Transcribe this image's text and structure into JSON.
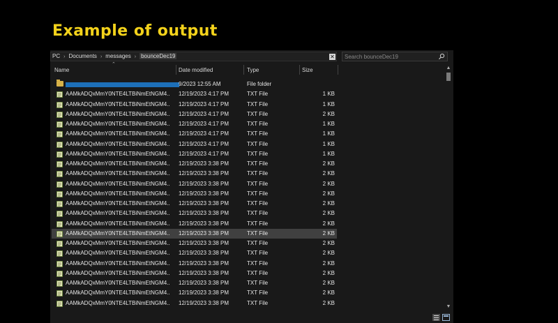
{
  "slide": {
    "title": "Example of output"
  },
  "address": {
    "crumbs": [
      "PC",
      "Documents",
      "messages",
      "bounceDec19"
    ],
    "clear_glyph": "✕"
  },
  "search": {
    "placeholder": "Search bounceDec19"
  },
  "columns": {
    "name": "Name",
    "date": "Date modified",
    "type": "Type",
    "size": "Size"
  },
  "folder_row": {
    "date": "9/2023 12:55 AM",
    "type": "File folder"
  },
  "files": [
    {
      "name": "AAMkADQxMmY0NTE4LTBiNmEtNGM4...",
      "date": "12/19/2023 4:17 PM",
      "type": "TXT File",
      "size": "1 KB"
    },
    {
      "name": "AAMkADQxMmY0NTE4LTBiNmEtNGM4...",
      "date": "12/19/2023 4:17 PM",
      "type": "TXT File",
      "size": "1 KB"
    },
    {
      "name": "AAMkADQxMmY0NTE4LTBiNmEtNGM4...",
      "date": "12/19/2023 4:17 PM",
      "type": "TXT File",
      "size": "2 KB"
    },
    {
      "name": "AAMkADQxMmY0NTE4LTBiNmEtNGM4...",
      "date": "12/19/2023 4:17 PM",
      "type": "TXT File",
      "size": "1 KB"
    },
    {
      "name": "AAMkADQxMmY0NTE4LTBiNmEtNGM4...",
      "date": "12/19/2023 4:17 PM",
      "type": "TXT File",
      "size": "1 KB"
    },
    {
      "name": "AAMkADQxMmY0NTE4LTBiNmEtNGM4...",
      "date": "12/19/2023 4:17 PM",
      "type": "TXT File",
      "size": "1 KB"
    },
    {
      "name": "AAMkADQxMmY0NTE4LTBiNmEtNGM4...",
      "date": "12/19/2023 4:17 PM",
      "type": "TXT File",
      "size": "1 KB"
    },
    {
      "name": "AAMkADQxMmY0NTE4LTBiNmEtNGM4...",
      "date": "12/19/2023 3:38 PM",
      "type": "TXT File",
      "size": "2 KB"
    },
    {
      "name": "AAMkADQxMmY0NTE4LTBiNmEtNGM4...",
      "date": "12/19/2023 3:38 PM",
      "type": "TXT File",
      "size": "2 KB"
    },
    {
      "name": "AAMkADQxMmY0NTE4LTBiNmEtNGM4...",
      "date": "12/19/2023 3:38 PM",
      "type": "TXT File",
      "size": "2 KB"
    },
    {
      "name": "AAMkADQxMmY0NTE4LTBiNmEtNGM4...",
      "date": "12/19/2023 3:38 PM",
      "type": "TXT File",
      "size": "2 KB"
    },
    {
      "name": "AAMkADQxMmY0NTE4LTBiNmEtNGM4...",
      "date": "12/19/2023 3:38 PM",
      "type": "TXT File",
      "size": "2 KB"
    },
    {
      "name": "AAMkADQxMmY0NTE4LTBiNmEtNGM4...",
      "date": "12/19/2023 3:38 PM",
      "type": "TXT File",
      "size": "2 KB"
    },
    {
      "name": "AAMkADQxMmY0NTE4LTBiNmEtNGM4...",
      "date": "12/19/2023 3:38 PM",
      "type": "TXT File",
      "size": "2 KB"
    },
    {
      "name": "AAMkADQxMmY0NTE4LTBiNmEtNGM4...",
      "date": "12/19/2023 3:38 PM",
      "type": "TXT File",
      "size": "2 KB",
      "highlighted": true
    },
    {
      "name": "AAMkADQxMmY0NTE4LTBiNmEtNGM4...",
      "date": "12/19/2023 3:38 PM",
      "type": "TXT File",
      "size": "2 KB"
    },
    {
      "name": "AAMkADQxMmY0NTE4LTBiNmEtNGM4...",
      "date": "12/19/2023 3:38 PM",
      "type": "TXT File",
      "size": "2 KB"
    },
    {
      "name": "AAMkADQxMmY0NTE4LTBiNmEtNGM4...",
      "date": "12/19/2023 3:38 PM",
      "type": "TXT File",
      "size": "2 KB"
    },
    {
      "name": "AAMkADQxMmY0NTE4LTBiNmEtNGM4...",
      "date": "12/19/2023 3:38 PM",
      "type": "TXT File",
      "size": "2 KB"
    },
    {
      "name": "AAMkADQxMmY0NTE4LTBiNmEtNGM4...",
      "date": "12/19/2023 3:38 PM",
      "type": "TXT File",
      "size": "2 KB"
    },
    {
      "name": "AAMkADQxMmY0NTE4LTBiNmEtNGM4...",
      "date": "12/19/2023 3:38 PM",
      "type": "TXT File",
      "size": "2 KB"
    },
    {
      "name": "AAMkADQxMmY0NTE4LTBiNmEtNGM4...",
      "date": "12/19/2023 3:38 PM",
      "type": "TXT File",
      "size": "2 KB"
    }
  ],
  "colors": {
    "title": "#f3d21b",
    "background": "#000000",
    "explorer_bg": "#191919",
    "text": "#e6e6e6",
    "row_highlight": "#404040",
    "redaction_bar": "#1d6fb8"
  },
  "icons": [
    "search-icon",
    "clear-icon",
    "folder-icon",
    "txt-file-icon",
    "details-view-icon",
    "tiles-view-icon"
  ]
}
